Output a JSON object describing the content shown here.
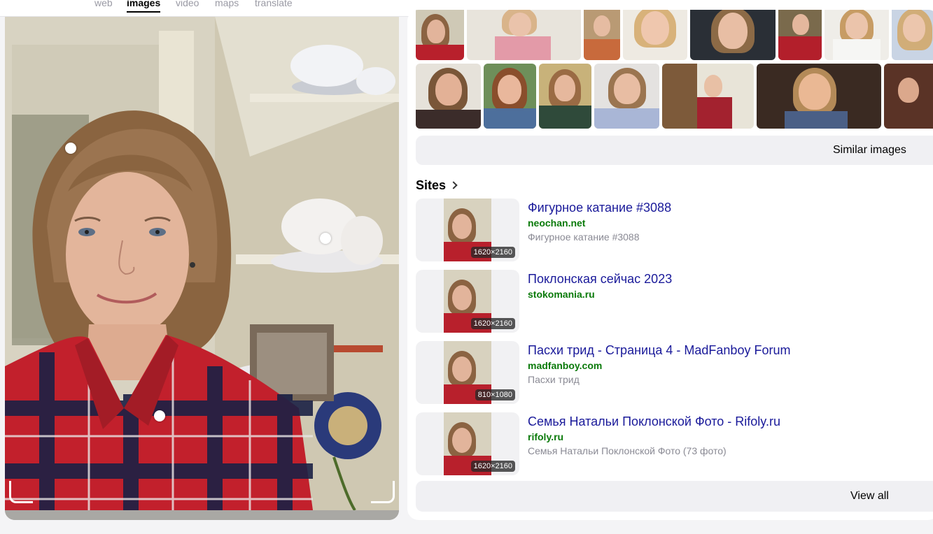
{
  "nav": {
    "tabs": [
      {
        "label": "web"
      },
      {
        "label": "images",
        "active": true
      },
      {
        "label": "video"
      },
      {
        "label": "maps"
      },
      {
        "label": "translate"
      }
    ]
  },
  "similar": {
    "button_label": "Similar images"
  },
  "sites": {
    "title": "Sites",
    "items": [
      {
        "title": "Фигурное катание #3088",
        "domain": "neochan.net",
        "desc": "Фигурное катание #3088",
        "resolution": "1620×2160"
      },
      {
        "title": "Поклонская сейчас 2023",
        "domain": "stokomania.ru",
        "desc": "",
        "resolution": "1620×2160"
      },
      {
        "title": "Пасхи трид - Страница 4 - MadFanboy Forum",
        "domain": "madfanboy.com",
        "desc": "Пасхи трид",
        "resolution": "810×1080"
      },
      {
        "title": "Семья Натальи Поклонской Фото - Rifoly.ru",
        "domain": "rifoly.ru",
        "desc": "Семья Натальи Поклонской Фото (73 фото)",
        "resolution": "1620×2160"
      }
    ],
    "view_all_label": "View all"
  },
  "colors": {
    "accent_link": "#1a1a9a",
    "domain_green": "#0a7a0a",
    "button_bg": "#f0f0f3"
  }
}
